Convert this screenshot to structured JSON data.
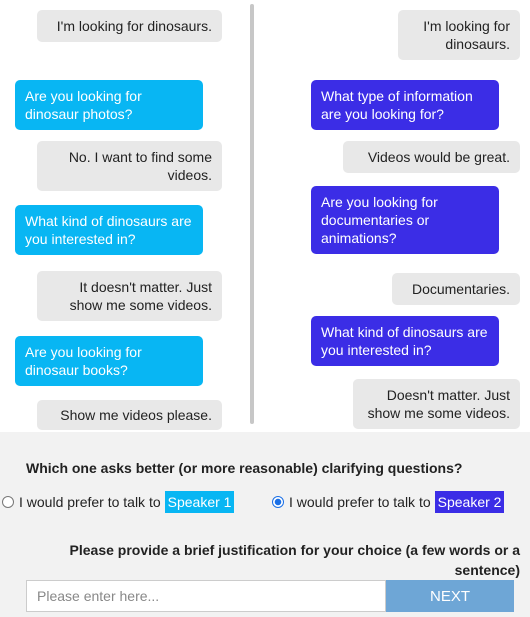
{
  "left_chat": {
    "speaker": "Speaker 1",
    "messages": [
      {
        "role": "user",
        "text": "I'm looking for dinosaurs."
      },
      {
        "role": "bot",
        "text": "Are you looking for dinosaur photos?"
      },
      {
        "role": "user",
        "text": "No. I want to find some videos."
      },
      {
        "role": "bot",
        "text": "What kind of dinosaurs are you interested in?"
      },
      {
        "role": "user",
        "text": "It doesn't matter. Just show me some videos."
      },
      {
        "role": "bot",
        "text": "Are you looking for dinosaur books?"
      },
      {
        "role": "user",
        "text": "Show me videos please."
      }
    ]
  },
  "right_chat": {
    "speaker": "Speaker 2",
    "messages": [
      {
        "role": "user",
        "text": "I'm looking for dinosaurs."
      },
      {
        "role": "bot",
        "text": "What type of information are you looking for?"
      },
      {
        "role": "user",
        "text": "Videos would be great."
      },
      {
        "role": "bot",
        "text": "Are you looking for documentaries or animations?"
      },
      {
        "role": "user",
        "text": "Documentaries."
      },
      {
        "role": "bot",
        "text": "What kind of dinosaurs are you interested in?"
      },
      {
        "role": "user",
        "text": "Doesn't matter. Just show me some videos."
      }
    ]
  },
  "question": "Which one asks better (or more reasonable) clarifying questions?",
  "options": [
    {
      "label": "I would prefer to talk to",
      "speaker": "Speaker 1",
      "checked": false
    },
    {
      "label": "I would prefer to talk to",
      "speaker": "Speaker 2",
      "checked": true
    }
  ],
  "justification_prompt": "Please provide a brief justification for your choice (a few words or a sentence)",
  "input_placeholder": "Please enter here...",
  "next_label": "NEXT",
  "colors": {
    "speaker1": "#08b6f3",
    "speaker2": "#3b2de6",
    "user_bubble": "#e8e8e8",
    "next_button": "#6ea6d6"
  }
}
